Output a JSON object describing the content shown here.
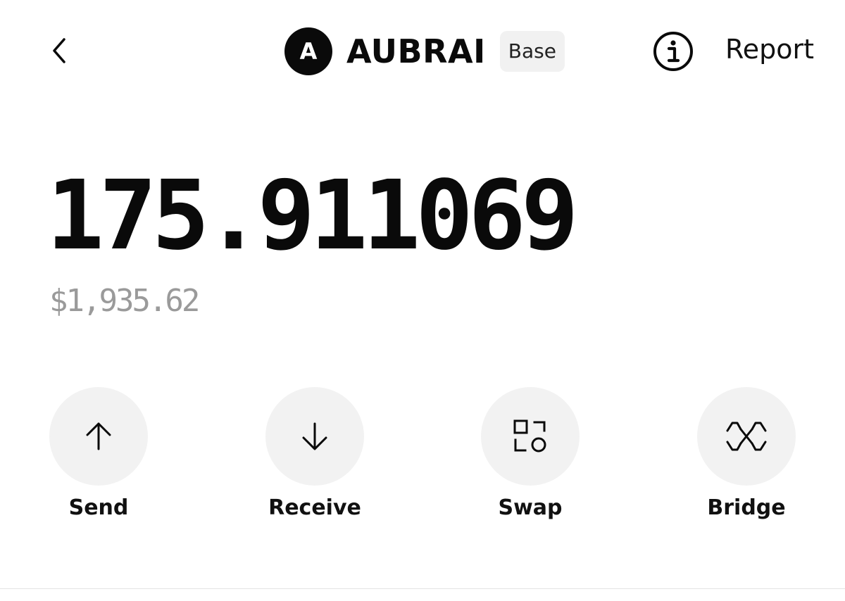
{
  "header": {
    "token_initial": "A",
    "token_name": "AUBRAI",
    "network": "Base",
    "report_label": "Report",
    "icons": {
      "back": "chevron-left-icon",
      "info": "info-icon"
    }
  },
  "balance": {
    "amount": "175.911069",
    "fiat": "$1,935.62"
  },
  "actions": [
    {
      "label": "Send",
      "icon": "arrow-up-icon"
    },
    {
      "label": "Receive",
      "icon": "arrow-down-icon"
    },
    {
      "label": "Swap",
      "icon": "swap-icon"
    },
    {
      "label": "Bridge",
      "icon": "bridge-icon"
    }
  ],
  "colors": {
    "text": "#0a0a0a",
    "muted": "#9a9a9a",
    "badge_bg": "#f1f1f1",
    "button_bg": "#f2f2f2"
  }
}
